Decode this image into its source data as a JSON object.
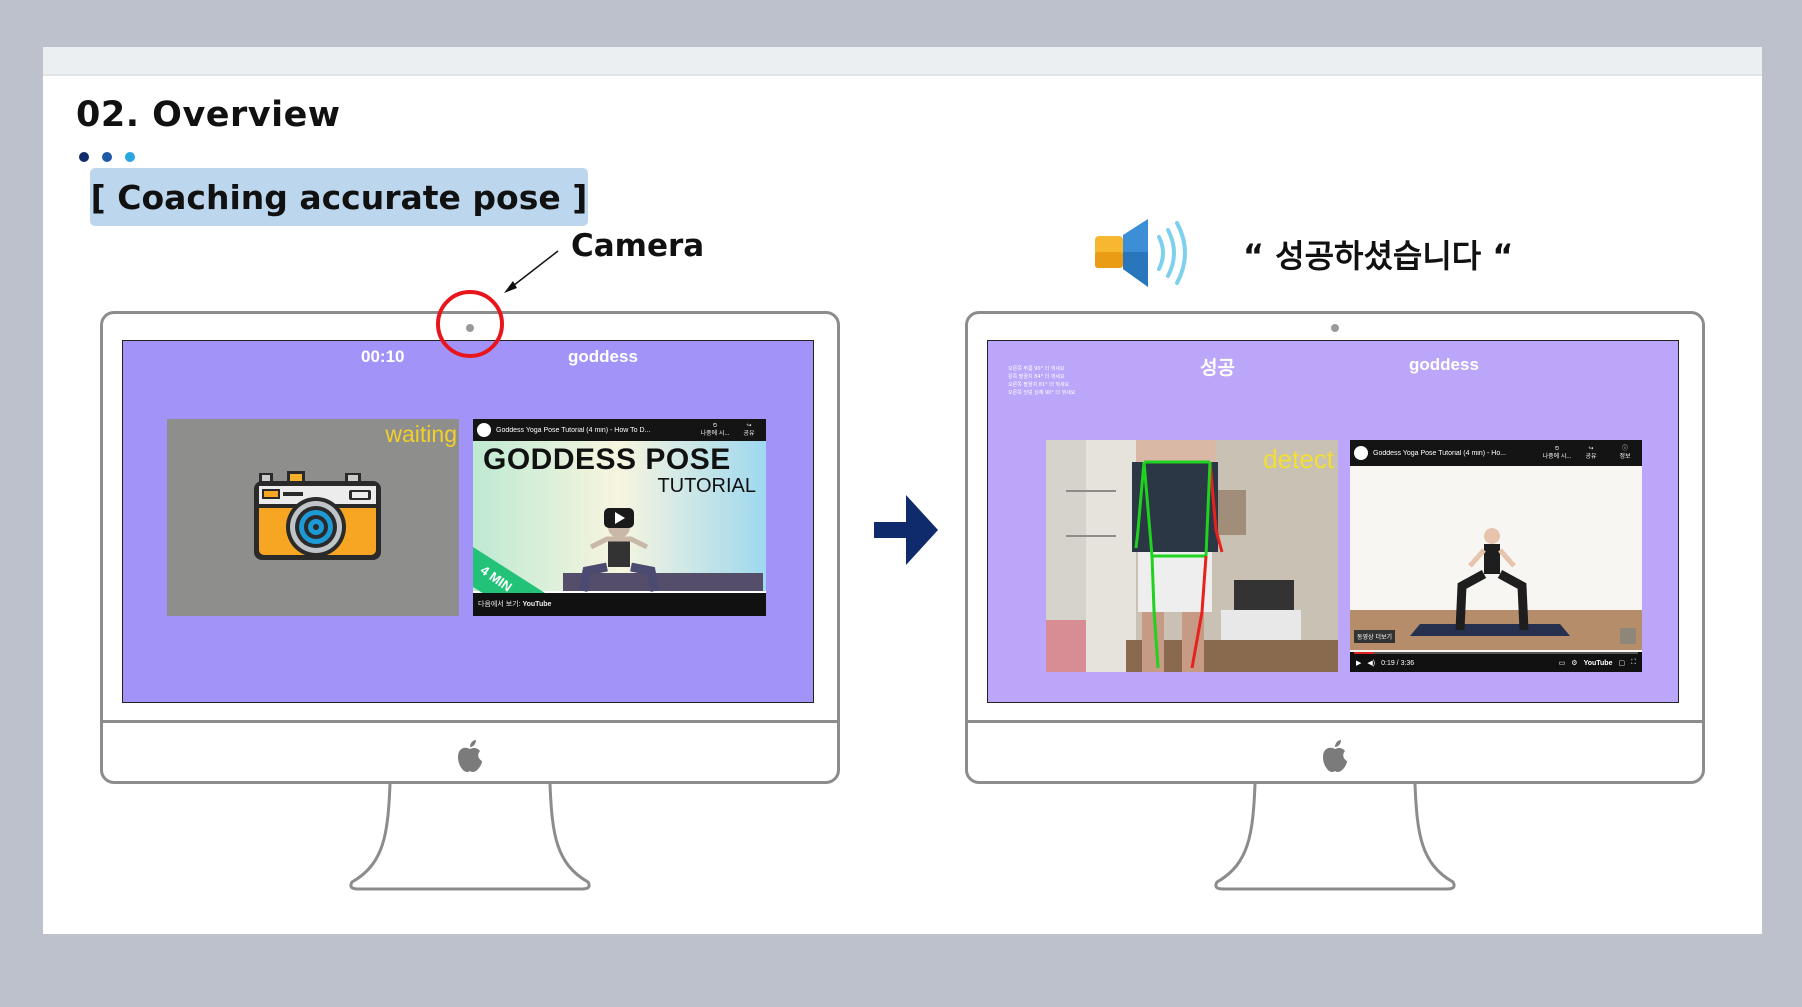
{
  "title": "02. Overview",
  "subtitle": "[ Coaching accurate pose ]",
  "camera_label": "Camera",
  "speech_text": "“ 성공하셨습니다 “",
  "colors": {
    "slide_bg": "#ffffff",
    "outer_bg": "#bcc1cb",
    "pill_bg": "#bcd6ee",
    "screen_left": "#a293f8",
    "screen_right": "#bba6f9",
    "highlight_circle": "#e8161c",
    "arrow": "#0f2b6b",
    "dot_colors": [
      "#0f2b6b",
      "#1f5aa8",
      "#29a6e0"
    ]
  },
  "left_screen": {
    "timer": "00:10",
    "pose_name": "goddess",
    "status_label": "waiting",
    "camera_icon": "camera-icon",
    "video": {
      "title": "Goddess Yoga Pose Tutorial (4 min) - How To D...",
      "headline": "GODDESS POSE",
      "subheadline": "TUTORIAL",
      "ribbon": "4 MIN",
      "watch_later": "나중에 시...",
      "share": "공유",
      "footer": "다음에서 보기:",
      "footer_brand": "YouTube"
    }
  },
  "right_screen": {
    "status": "성공",
    "pose_name": "goddess",
    "detect_label": "detect",
    "feedback_lines": [
      "오른쪽 무릎 90° 더 꺾세요",
      "왼쪽 팔꿈치 84° 더 꺾세요",
      "오른쪽 팔꿈치 81° 더 꺾세요",
      "오른쪽 엉덩 상체 90° 더 꺾세요"
    ],
    "video": {
      "title": "Goddess Yoga Pose Tutorial (4 min) - Ho...",
      "watch_later": "나중에 시...",
      "share": "공유",
      "info": "정보",
      "time": "0:19 / 3:36",
      "more_videos": "동영상 더보기",
      "footer_brand": "YouTube"
    }
  }
}
